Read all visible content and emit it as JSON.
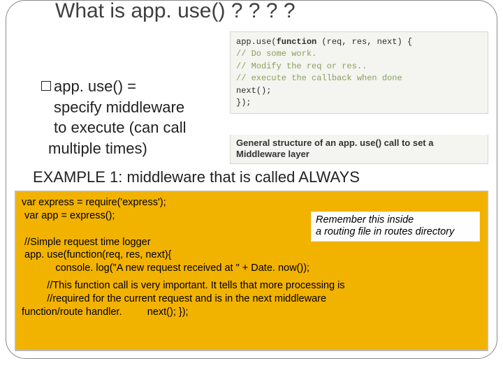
{
  "title": "What is app. use()  ? ? ? ?",
  "codeImage": {
    "line1a": "app.use(",
    "line1b": "function",
    "line1c": " (req, res, next) {",
    "line2": "  // Do some work.",
    "blank1": " ",
    "line3": "  // Modify the req or res..",
    "blank2": " ",
    "line4": "  // execute the callback when done",
    "line5": "  next();",
    "line6": "});"
  },
  "caption": "General structure of an app. use() call to set a Middleware layer",
  "bullet": {
    "line1": "app. use() =",
    "line2": "specify middleware",
    "line3": "to execute (can call",
    "line4": "multiple times)"
  },
  "exampleTitle": "EXAMPLE 1: middleware that is called ALWAYS",
  "code": {
    "l1": "var express = require('express');",
    "l2": " var app = express();",
    "blank": " ",
    "l3": " //Simple request time logger",
    "l4": " app. use(function(req, res, next){",
    "l5": "            console. log(\"A new request received at \" + Date. now());",
    "l6": "         //This function call is very important. It tells that more processing is",
    "l7": "         //required for the current request and is in the next middleware",
    "l8": "function/route handler.         next(); });"
  },
  "note": {
    "line1": "Remember this inside",
    "line2": "a routing file in routes directory"
  }
}
